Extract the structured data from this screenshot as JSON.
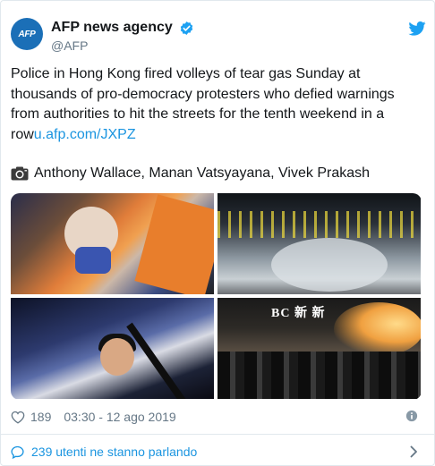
{
  "account": {
    "display_name": "AFP news agency",
    "handle": "@AFP",
    "avatar_label": "AFP",
    "verified": true
  },
  "tweet": {
    "text_main": "Police in Hong Kong fired volleys of tear gas Sunday at thousands of pro-democracy protesters who defied warnings from authorities to hit the streets for the tenth weekend in a row",
    "link_text": "u.afp.com/JXPZ",
    "credit": "Anthony Wallace, Manan Vatsyayana, Vivek Prakash"
  },
  "photos": [
    {
      "name": "injured-protester-photo"
    },
    {
      "name": "tear-gas-crowd-photo"
    },
    {
      "name": "arrested-protester-photo"
    },
    {
      "name": "riot-police-photo"
    }
  ],
  "photo4_sign": "BC 新 新",
  "meta": {
    "likes": "189",
    "timestamp": "03:30 - 12 ago 2019"
  },
  "footer": {
    "conversation_label": "239 utenti ne stanno parlando"
  },
  "colors": {
    "link": "#1b95e0",
    "secondary_text": "#657786",
    "twitter_blue": "#1da1f2",
    "avatar_bg": "#1b6fb7"
  },
  "icons": [
    "twitter-bird-icon",
    "verified-badge-icon",
    "camera-icon",
    "heart-icon",
    "info-icon",
    "speech-bubble-icon",
    "chevron-right-icon"
  ]
}
